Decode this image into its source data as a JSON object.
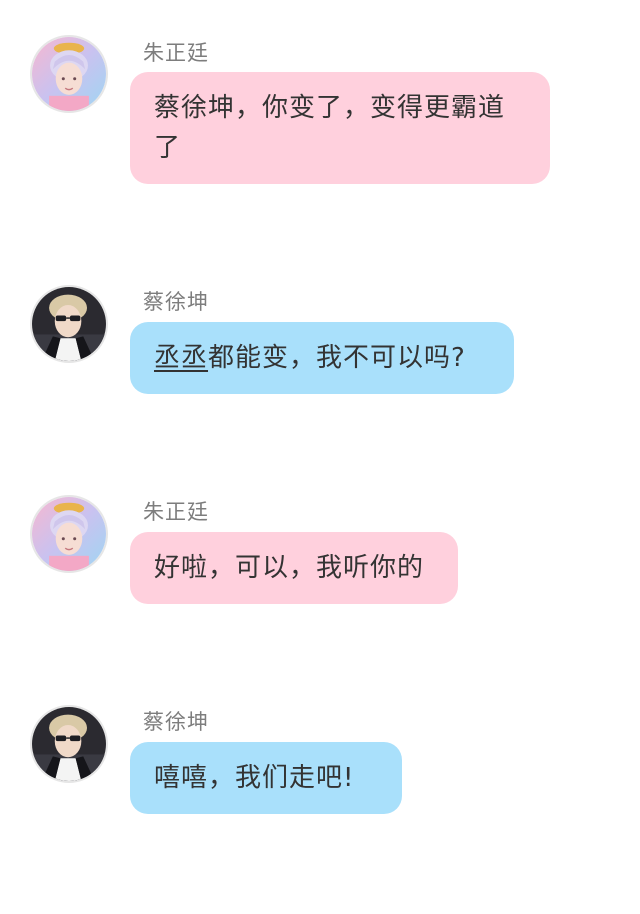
{
  "messages": [
    {
      "sender": "朱正廷",
      "text": "蔡徐坤，你变了，变得更霸道了",
      "bubble_color": "#ffd0dd",
      "avatar_icon": "avatar-zhu-zhengting"
    },
    {
      "sender": "蔡徐坤",
      "text_underlined": "丞丞",
      "text": "都能变，我不可以吗?",
      "bubble_color": "#a9e0fb",
      "avatar_icon": "avatar-cai-xukun"
    },
    {
      "sender": "朱正廷",
      "text": "好啦，可以，我听你的",
      "bubble_color": "#ffd0dd",
      "avatar_icon": "avatar-zhu-zhengting"
    },
    {
      "sender": "蔡徐坤",
      "text": "嘻嘻，我们走吧!",
      "bubble_color": "#a9e0fb",
      "avatar_icon": "avatar-cai-xukun"
    }
  ]
}
